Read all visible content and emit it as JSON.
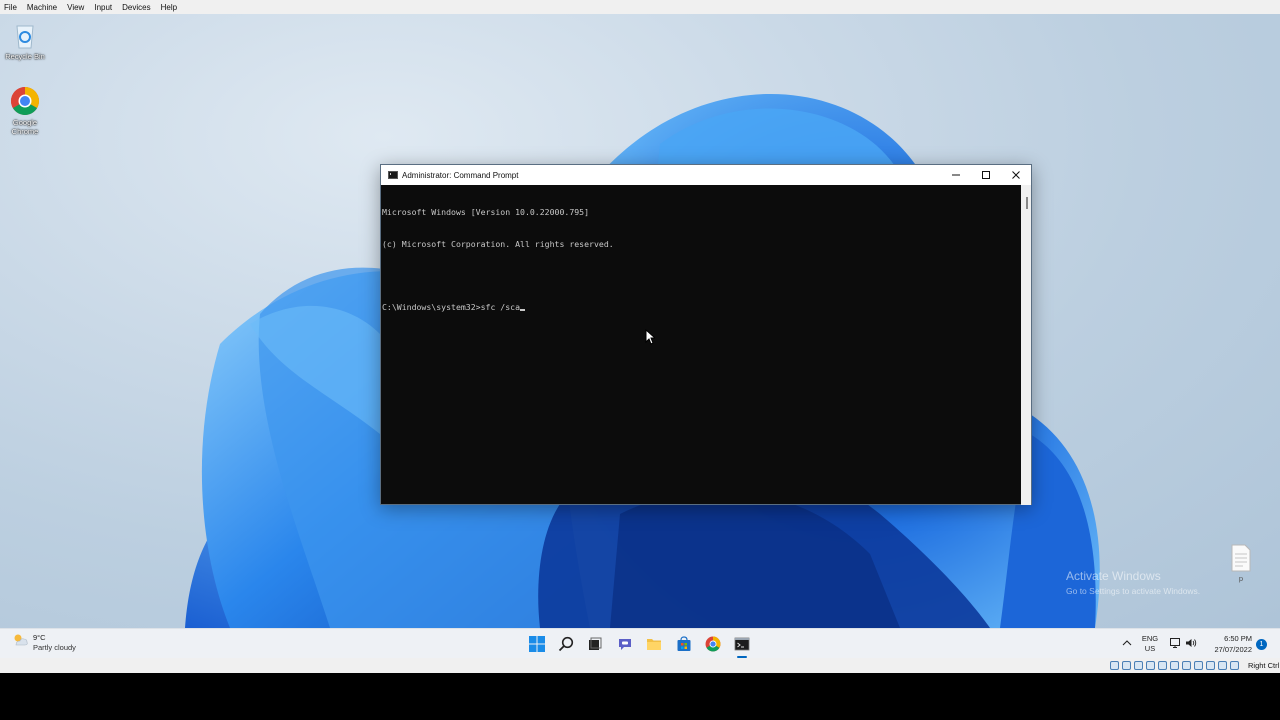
{
  "vbox_menu": {
    "items": [
      "File",
      "Machine",
      "View",
      "Input",
      "Devices",
      "Help"
    ]
  },
  "desktop": {
    "icons": [
      {
        "label": "Recycle Bin",
        "icon": "recycle-bin-icon"
      },
      {
        "label": "Google Chrome",
        "icon": "chrome-icon"
      },
      {
        "label": "p",
        "icon": "text-file-icon"
      }
    ],
    "watermark": {
      "title": "Activate Windows",
      "subtitle": "Go to Settings to activate Windows."
    }
  },
  "cmd": {
    "title": "Administrator: Command Prompt",
    "lines": [
      "Microsoft Windows [Version 10.0.22000.795]",
      "(c) Microsoft Corporation. All rights reserved.",
      "",
      "C:\\Windows\\system32>sfc /sca"
    ],
    "colors": {
      "background": "#0c0c0c",
      "text": "#c8c8c8"
    }
  },
  "taskbar": {
    "weather": {
      "temp": "9°C",
      "condition": "Partly cloudy"
    },
    "apps": [
      "start-icon",
      "search-icon",
      "task-view-icon",
      "chat-icon",
      "file-explorer-icon",
      "store-icon",
      "chrome-icon",
      "terminal-icon"
    ],
    "active_app": "terminal-icon",
    "lang": {
      "line1": "ENG",
      "line2": "US"
    },
    "clock": {
      "time": "6:50 PM",
      "date": "27/07/2022"
    },
    "notifications": "1",
    "accent": "#0067c0"
  },
  "vbox_status": {
    "host_key": "Right Ctrl"
  }
}
